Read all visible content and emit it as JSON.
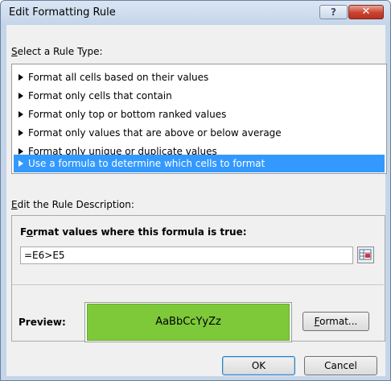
{
  "window": {
    "title": "Edit Formatting Rule",
    "help_label": "?",
    "close_label": "✕"
  },
  "rule_type": {
    "heading_prefix": "S",
    "heading_rest": "elect a Rule Type:",
    "items": [
      {
        "label": "Format all cells based on their values"
      },
      {
        "label": "Format only cells that contain"
      },
      {
        "label": "Format only top or bottom ranked values"
      },
      {
        "label": "Format only values that are above or below average"
      },
      {
        "label": "Format only unique or duplicate values"
      },
      {
        "label": "Use a formula to determine which cells to format"
      }
    ],
    "selected_index": 5
  },
  "description": {
    "heading_prefix": "E",
    "heading_rest": "dit the Rule Description:",
    "formula_label_pre": "F",
    "formula_label_u": "o",
    "formula_label_post": "rmat values where this formula is true:",
    "formula_value": "=E6>E5",
    "preview_label": "Preview:",
    "preview_sample": "AaBbCcYyZz",
    "format_button_u": "F",
    "format_button_rest": "ormat..."
  },
  "footer": {
    "ok_label": "OK",
    "cancel_label": "Cancel"
  },
  "colors": {
    "selection": "#3399ff",
    "preview_fill": "#7dc93a"
  }
}
